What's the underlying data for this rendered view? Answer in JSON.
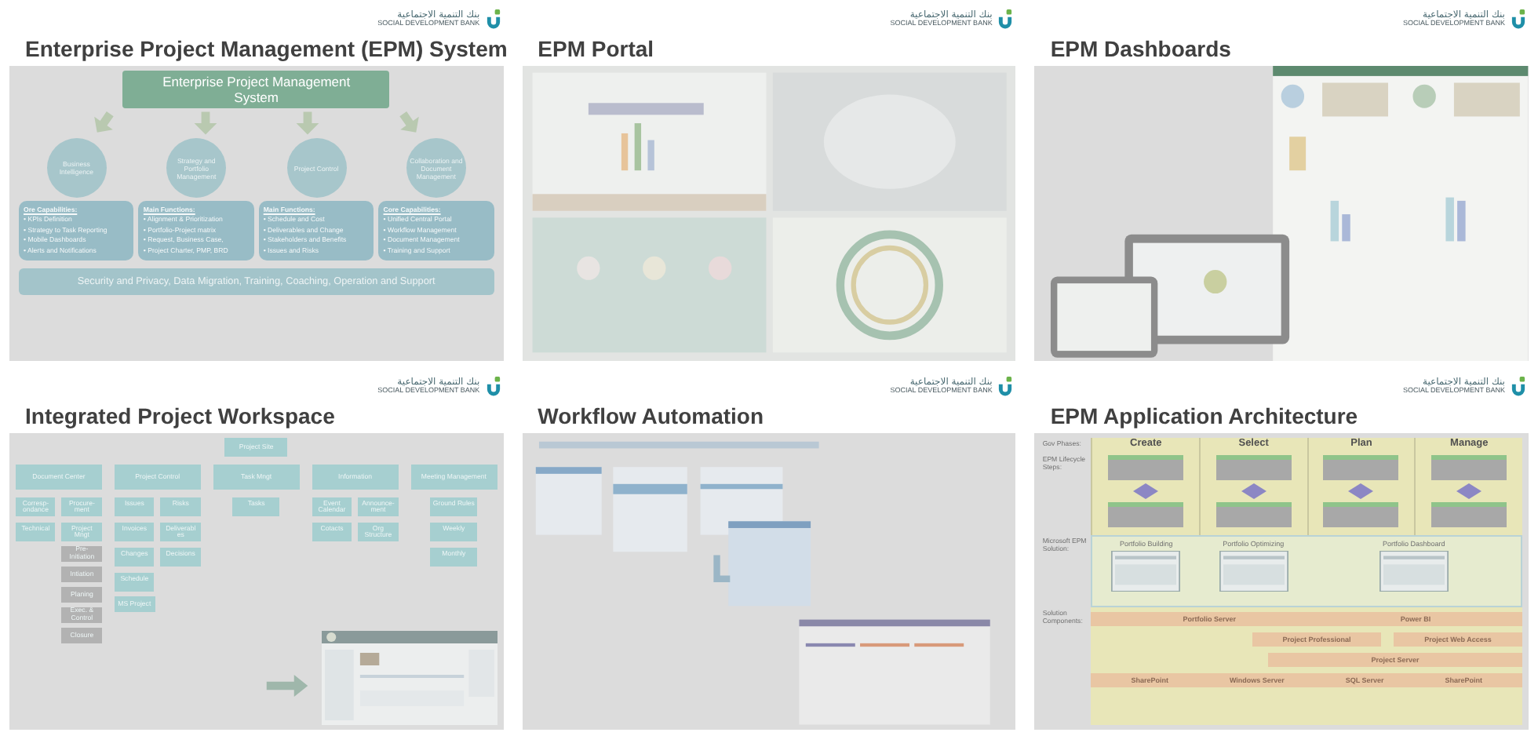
{
  "slides": [
    {
      "kind": "capabilities",
      "title": "Enterprise Project Management (EPM) System",
      "logo": {
        "arabic": "بنك التنمية الاجتماعية",
        "english": "SOCIAL DEVELOPMENT BANK"
      },
      "root": "Enterprise Project Management System",
      "pillars": [
        {
          "name": "Business Intelligence",
          "heading": "Ore Capabilities:",
          "items": [
            "• KPIs Definition",
            "• Strategy to Task Reporting",
            "• Mobile Dashboards",
            "• Alerts and Notifications"
          ]
        },
        {
          "name": "Strategy and Portfolio Management",
          "heading": "Main Functions:",
          "items": [
            "• Alignment & Prioritization",
            "• Portfolio-Project matrix",
            "• Request, Business Case,",
            "• Project Charter, PMP, BRD"
          ]
        },
        {
          "name": "Project Control",
          "heading": "Main Functions:",
          "items": [
            "• Schedule and Cost",
            "• Deliverables and Change",
            "• Stakeholders and Benefits",
            "• Issues and Risks"
          ]
        },
        {
          "name": "Collaboration and Document Management",
          "heading": "Core Capabilities:",
          "items": [
            "• Unified Central Portal",
            "• Workflow Management",
            "• Document Management",
            "• Training and Support"
          ]
        }
      ],
      "footer": "Security and Privacy, Data Migration, Training, Coaching, Operation and Support"
    },
    {
      "kind": "portal",
      "title": "EPM Portal",
      "logo": {
        "arabic": "بنك التنمية الاجتماعية",
        "english": "SOCIAL DEVELOPMENT BANK"
      }
    },
    {
      "kind": "dashboards",
      "title": "EPM Dashboards",
      "logo": {
        "arabic": "بنك التنمية الاجتماعية",
        "english": "SOCIAL DEVELOPMENT BANK"
      }
    },
    {
      "kind": "tree",
      "title": "Integrated Project Workspace",
      "logo": {
        "arabic": "بنك التنمية الاجتماعية",
        "english": "SOCIAL DEVELOPMENT BANK"
      },
      "root": "Project Site",
      "branches": [
        {
          "label": "Document Center",
          "children": [
            {
              "label": "Corresp-ondance"
            },
            {
              "label": "Procure-ment"
            },
            {
              "label": "Technical"
            },
            {
              "label": "Project Mngt",
              "children": [
                {
                  "label": "Pre-Initiation"
                },
                {
                  "label": "Intiation"
                },
                {
                  "label": "Planing"
                },
                {
                  "label": "Exec. & Control"
                },
                {
                  "label": "Closure"
                }
              ]
            }
          ]
        },
        {
          "label": "Project Control",
          "children": [
            {
              "label": "Issues"
            },
            {
              "label": "Risks"
            },
            {
              "label": "Invoices"
            },
            {
              "label": "Deliverabl es"
            },
            {
              "label": "Changes"
            },
            {
              "label": "Decisions"
            },
            {
              "label": "Schedule",
              "children": [
                {
                  "label": "MS Project"
                }
              ]
            }
          ]
        },
        {
          "label": "Task Mngt",
          "children": [
            {
              "label": "Tasks"
            }
          ]
        },
        {
          "label": "Information",
          "children": [
            {
              "label": "Event Calendar"
            },
            {
              "label": "Announce-ment"
            },
            {
              "label": "Cotacts"
            },
            {
              "label": "Org Structure"
            }
          ]
        },
        {
          "label": "Meeting Management",
          "children": [
            {
              "label": "Ground Rules"
            },
            {
              "label": "Weekly"
            },
            {
              "label": "Monthly"
            }
          ]
        }
      ]
    },
    {
      "kind": "workflow",
      "title": "Workflow Automation",
      "logo": {
        "arabic": "بنك التنمية الاجتماعية",
        "english": "SOCIAL DEVELOPMENT BANK"
      }
    },
    {
      "kind": "architecture",
      "title": "EPM Application Architecture",
      "logo": {
        "arabic": "بنك التنمية الاجتماعية",
        "english": "SOCIAL DEVELOPMENT BANK"
      },
      "row_labels": [
        "Gov Phases:",
        "EPM Lifecycle Steps:",
        "Microsoft EPM Solution:",
        "Solution Components:"
      ],
      "phases": [
        "Create",
        "Select",
        "Plan",
        "Manage"
      ],
      "solutions": [
        "Portfolio Building",
        "Portfolio Optimizing",
        "Portfolio Dashboard"
      ],
      "portfolio_bar": [
        "Portfolio Server",
        "Power BI"
      ],
      "project_tools": [
        "Project Professional",
        "Project Web Access"
      ],
      "project_server": "Project Server",
      "platform_bar": [
        "SharePoint",
        "Windows Server",
        "SQL Server",
        "SharePoint"
      ]
    }
  ]
}
